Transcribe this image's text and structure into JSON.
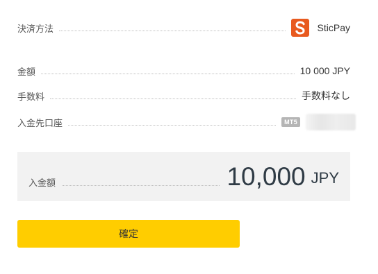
{
  "payment_method": {
    "label": "決済方法",
    "value": "SticPay",
    "logo_letter": "S",
    "logo_color": "#e85a1f"
  },
  "amount": {
    "label": "金額",
    "value": "10 000 JPY"
  },
  "fee": {
    "label": "手数料",
    "value": "手数料なし"
  },
  "deposit_account": {
    "label": "入金先口座",
    "badge": "MT5"
  },
  "total": {
    "label": "入金額",
    "amount": "10,000",
    "currency": "JPY"
  },
  "confirm_button": {
    "label": "確定",
    "color": "#ffcd00"
  }
}
